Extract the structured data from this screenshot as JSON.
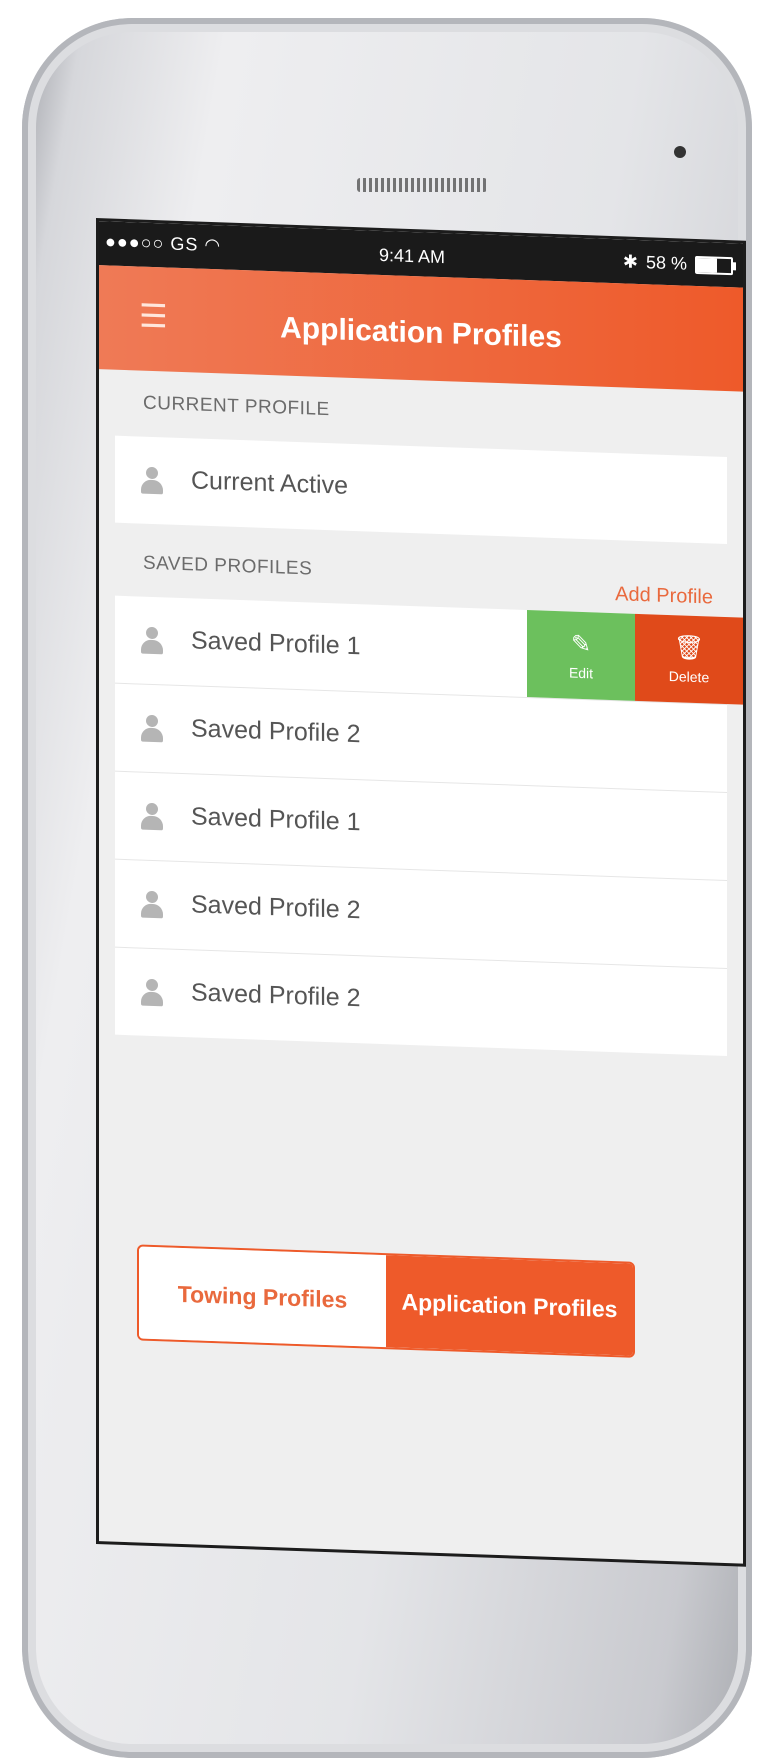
{
  "status_bar": {
    "carrier": "●●●○○ GS",
    "wifi_icon": "wifi-icon",
    "time": "9:41 AM",
    "bluetooth": "✱",
    "battery_percent": "58 %",
    "battery_level": 0.58
  },
  "navbar": {
    "menu_icon": "hamburger-menu-icon",
    "title": "Application Profiles"
  },
  "current_section": {
    "label": "CURRENT PROFILE",
    "item": "Current Active"
  },
  "saved_section": {
    "label": "SAVED PROFILES",
    "add_label": "Add Profile",
    "items": [
      {
        "label": "Saved Profile 1"
      },
      {
        "label": "Saved Profile 2"
      },
      {
        "label": "Saved Profile 1"
      },
      {
        "label": "Saved Profile 2"
      },
      {
        "label": "Saved Profile 2"
      }
    ],
    "actions": {
      "edit": "Edit",
      "delete": "Delete"
    }
  },
  "tabs": {
    "towing": "Towing Profiles",
    "application": "Application Profiles",
    "active": "application"
  },
  "colors": {
    "accent": "#ee5a2a",
    "edit": "#6cc05d",
    "delete": "#e04a1a"
  }
}
